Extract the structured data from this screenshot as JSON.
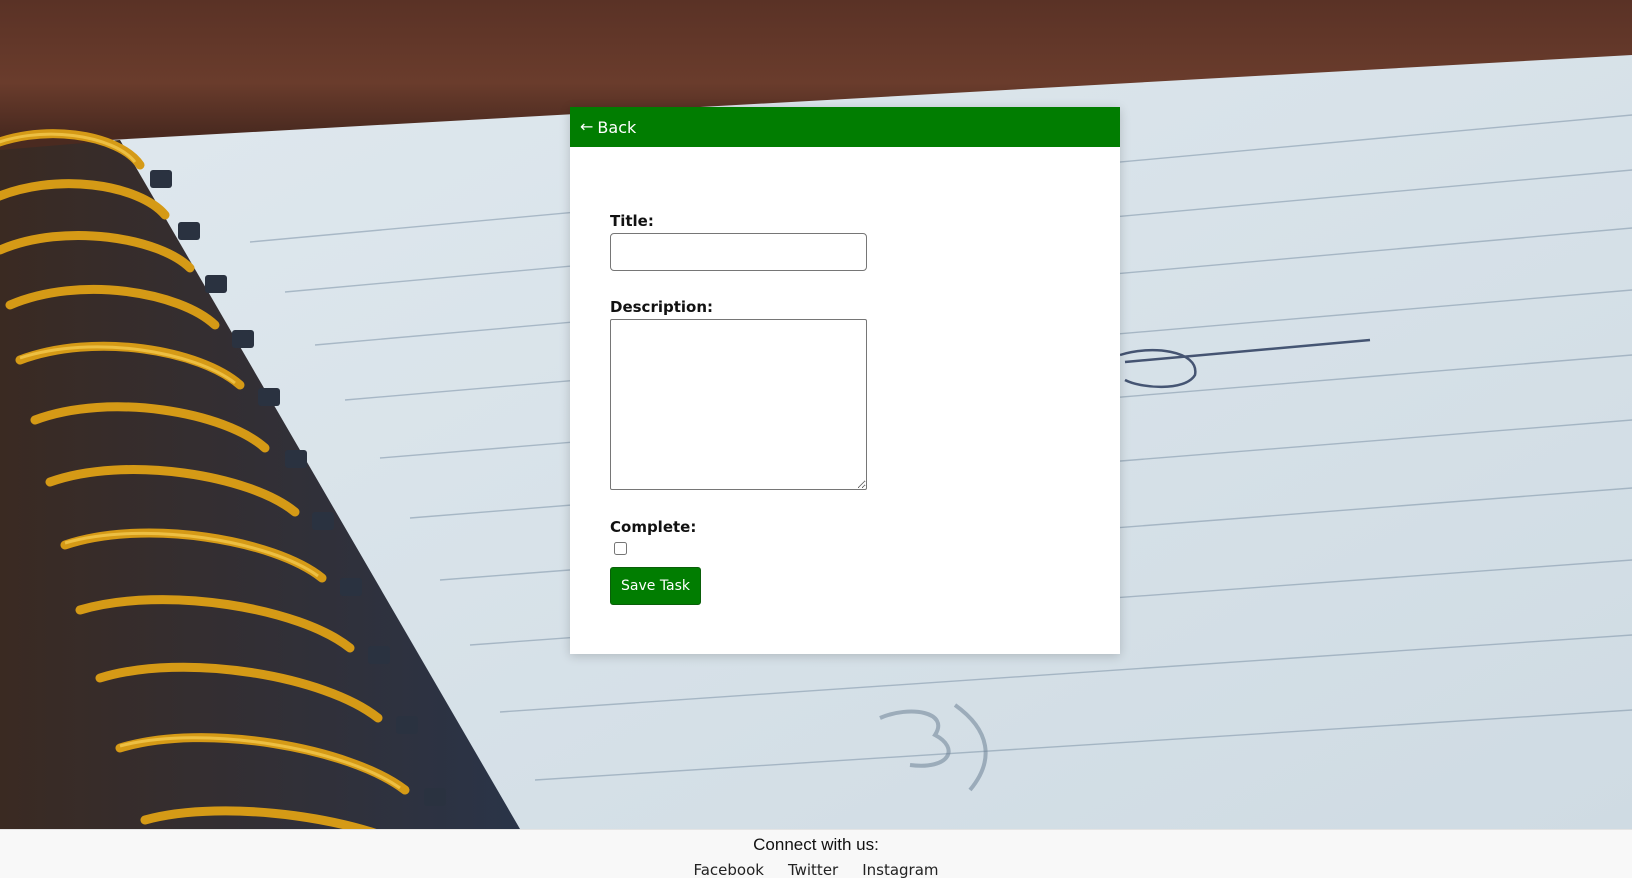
{
  "card": {
    "back_label": "Back",
    "back_icon": "left-arrow-icon"
  },
  "form": {
    "title_label": "Title:",
    "title_value": "",
    "description_label": "Description:",
    "description_value": "",
    "complete_label": "Complete:",
    "complete_checked": false,
    "save_label": "Save Task"
  },
  "footer": {
    "heading": "Connect with us:",
    "links": [
      "Facebook",
      "Twitter",
      "Instagram"
    ]
  },
  "colors": {
    "accent": "#017d01",
    "card_bg": "#ffffff",
    "footer_bg": "#f8f8f8"
  }
}
